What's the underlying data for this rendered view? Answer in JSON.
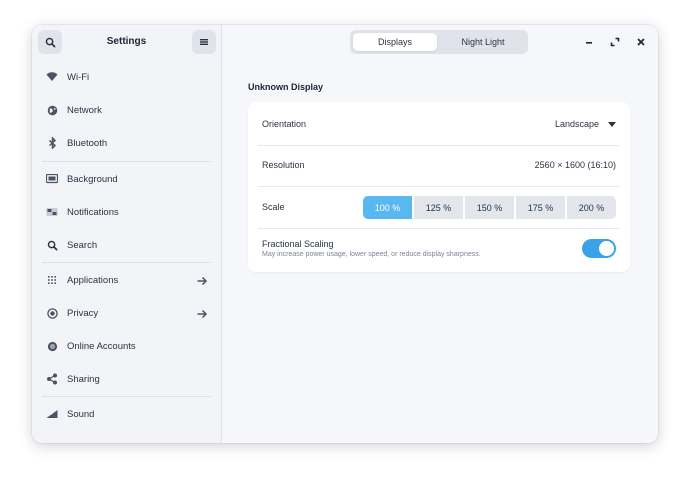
{
  "sidebar": {
    "title": "Settings",
    "items": [
      {
        "label": "Wi-Fi",
        "icon": "wifi-icon"
      },
      {
        "label": "Network",
        "icon": "network-globe-icon"
      },
      {
        "label": "Bluetooth",
        "icon": "bluetooth-icon"
      },
      {
        "label": "Background",
        "icon": "background-icon"
      },
      {
        "label": "Notifications",
        "icon": "notifications-icon"
      },
      {
        "label": "Search",
        "icon": "search-icon"
      },
      {
        "label": "Applications",
        "icon": "applications-grid-icon"
      },
      {
        "label": "Privacy",
        "icon": "privacy-icon"
      },
      {
        "label": "Online Accounts",
        "icon": "online-accounts-icon"
      },
      {
        "label": "Sharing",
        "icon": "sharing-icon"
      },
      {
        "label": "Sound",
        "icon": "sound-icon"
      }
    ]
  },
  "header": {
    "tabs": [
      {
        "label": "Displays",
        "active": true
      },
      {
        "label": "Night Light",
        "active": false
      }
    ]
  },
  "display": {
    "name": "Unknown Display",
    "orientation_label": "Orientation",
    "orientation_value": "Landscape",
    "resolution_label": "Resolution",
    "resolution_value": "2560 × 1600 (16:10)",
    "scale_label": "Scale",
    "scale_options": [
      "100 %",
      "125 %",
      "150 %",
      "175 %",
      "200 %"
    ],
    "scale_selected": "100 %",
    "fractional_title": "Fractional Scaling",
    "fractional_subtitle": "May increase power usage, lower speed, or reduce display sharpness.",
    "fractional_enabled": true
  },
  "colors": {
    "accent": "#3aa3e8",
    "scale_selected": "#58b8ef"
  }
}
